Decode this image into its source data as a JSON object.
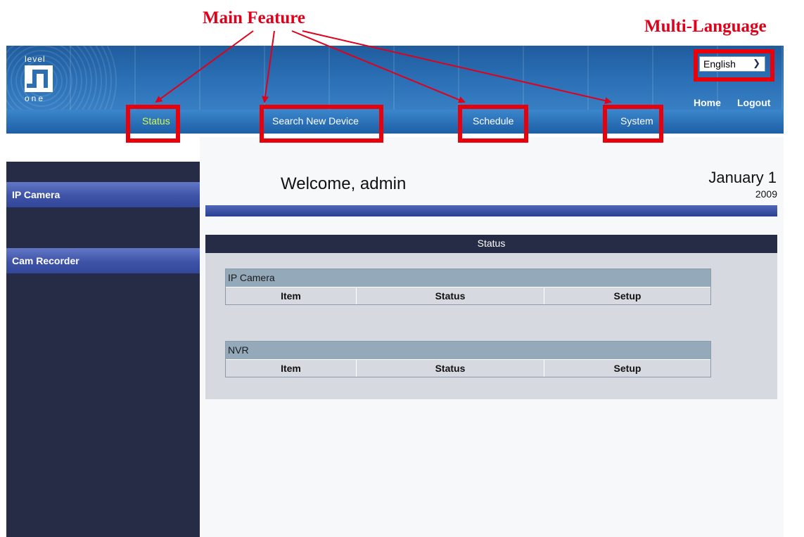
{
  "annotations": {
    "main_feature": "Main Feature",
    "multi_language": "Multi-Language"
  },
  "logo": {
    "top_text": "level",
    "bottom_text": "one"
  },
  "nav": {
    "items": [
      {
        "label": "Status",
        "active": true
      },
      {
        "label": "Search New Device"
      },
      {
        "label": "Schedule"
      },
      {
        "label": "System"
      }
    ]
  },
  "language": {
    "selected": "English"
  },
  "top_links": {
    "home": "Home",
    "logout": "Logout"
  },
  "sidebar": {
    "items": [
      {
        "label": "IP Camera"
      },
      {
        "label": "Cam Recorder"
      }
    ]
  },
  "welcome": {
    "text": "Welcome, admin",
    "date_day": "January 1",
    "date_year": "2009"
  },
  "status": {
    "title": "Status",
    "tables": [
      {
        "title": "IP Camera",
        "columns": [
          "Item",
          "Status",
          "Setup"
        ]
      },
      {
        "title": "NVR",
        "columns": [
          "Item",
          "Status",
          "Setup"
        ]
      }
    ]
  },
  "colors": {
    "highlight_red": "#e8000b",
    "callout_red": "#e0001a",
    "header_blue": "#2d72b8",
    "sidebar_navy": "#262c46",
    "active_nav_text": "#d6f84a"
  }
}
